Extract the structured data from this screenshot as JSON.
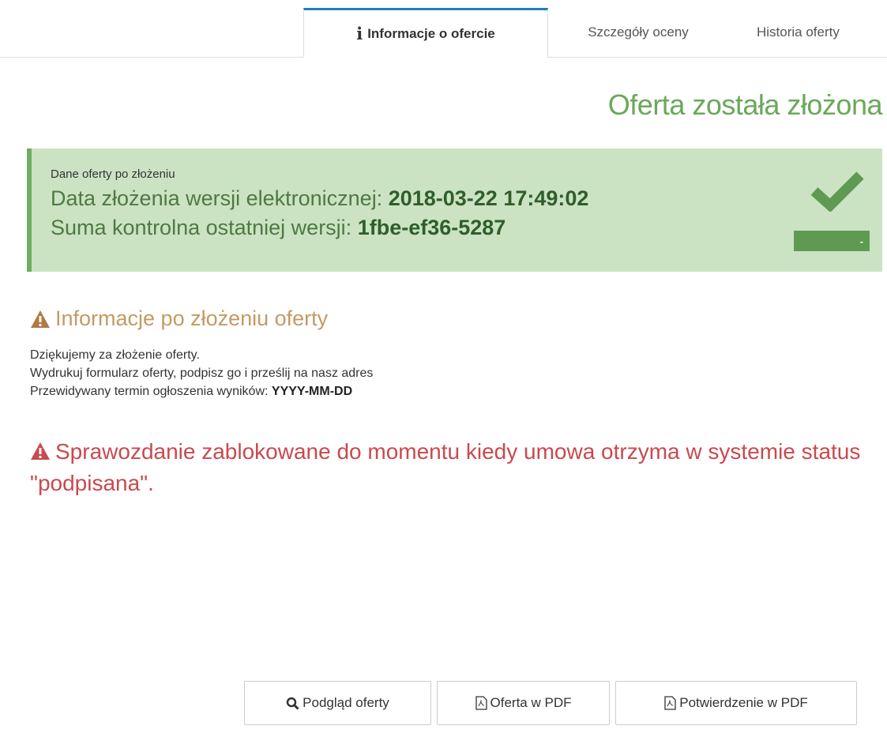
{
  "tabs": [
    {
      "label": "Informacje o ofercie",
      "active": true,
      "icon": "info-icon"
    },
    {
      "label": "Szczegóły oceny",
      "active": false
    },
    {
      "label": "Historia oferty",
      "active": false
    }
  ],
  "status_title": "Oferta została złożona",
  "submission": {
    "caption": "Dane oferty po złożeniu",
    "date_label": "Data złożenia wersji elektronicznej: ",
    "date_value": "2018-03-22 17:49:02",
    "checksum_label": "Suma kontrolna ostatniej wersji: ",
    "checksum_value": "1fbe-ef36-5287",
    "bar_text": "-"
  },
  "info": {
    "heading": "Informacje po złożeniu oferty",
    "line1": "Dziękujemy za złożenie oferty.",
    "line2": "Wydrukuj formularz oferty, podpisz go i prześlij na nasz adres",
    "line3_label": "Przewidywany termin ogłoszenia wyników: ",
    "line3_value": "YYYY-MM-DD"
  },
  "blocked_message": "Sprawozdanie zablokowane do momentu kiedy umowa otrzyma w systemie status \"podpisana\".",
  "buttons": {
    "preview": "Podgląd oferty",
    "offer_pdf": "Oferta w PDF",
    "confirmation_pdf": "Potwierdzenie w PDF"
  },
  "colors": {
    "accent": "#1f7fb8",
    "success_bg": "#cbe3c3",
    "success_text": "#6aa85a",
    "warning": "#c49a63",
    "danger": "#c9494f"
  }
}
